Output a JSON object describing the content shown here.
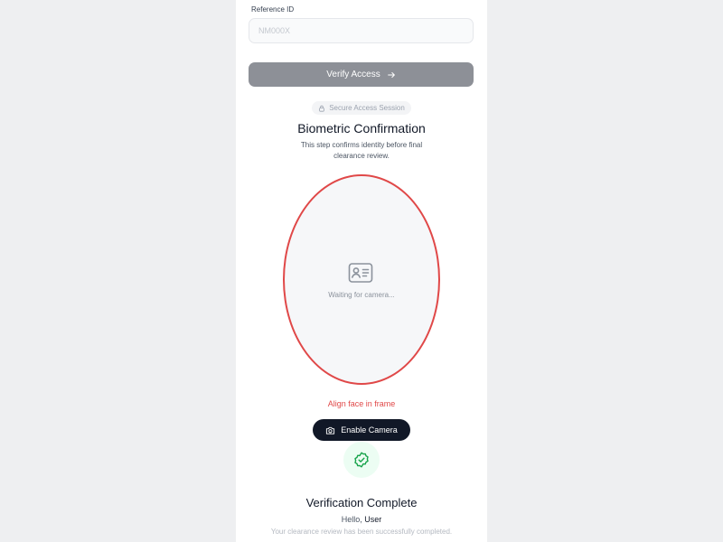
{
  "reference": {
    "label": "Reference ID",
    "placeholder": "NM000X",
    "value": ""
  },
  "verify_button": {
    "label": "Verify Access",
    "icon": "arrow-right-icon"
  },
  "session_badge": {
    "label": "Secure Access Session",
    "icon": "lock-icon"
  },
  "biometric": {
    "title": "Biometric Confirmation",
    "description": "This step confirms identity before final clearance review.",
    "camera_status": "Waiting for camera...",
    "camera_icon": "id-card-icon",
    "align_hint": "Align face in frame"
  },
  "enable_camera_button": {
    "label": "Enable Camera",
    "icon": "camera-icon"
  },
  "completion": {
    "icon": "badge-check-icon",
    "title": "Verification Complete",
    "greeting": "Hello,",
    "user_name": "User",
    "message": "Your clearance review has been successfully completed."
  },
  "colors": {
    "accent_red": "#e04848",
    "dark_button": "#111827",
    "disabled_button": "#8d9097",
    "success_green": "#16a34a",
    "success_bg": "#ecfdf3"
  }
}
